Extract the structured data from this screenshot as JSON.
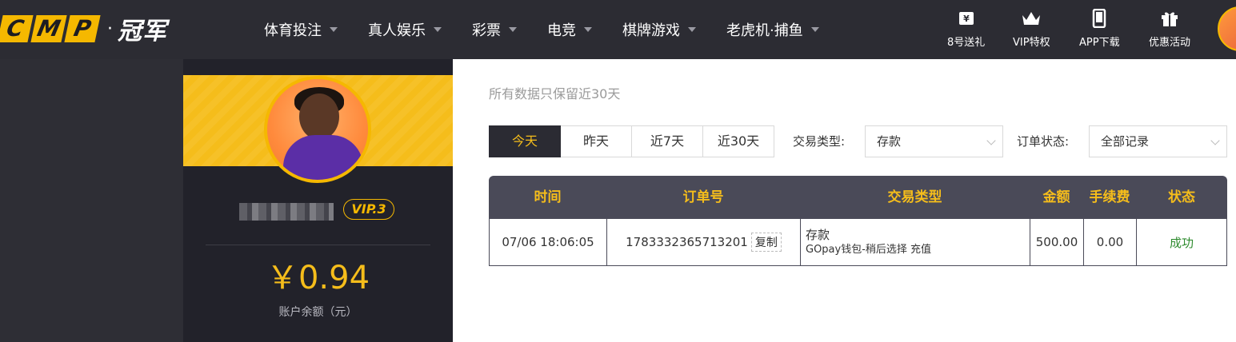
{
  "header": {
    "logo_letters": [
      "C",
      "M",
      "P"
    ],
    "logo_dot": "·",
    "brand": "冠军",
    "nav": [
      {
        "label": "体育投注"
      },
      {
        "label": "真人娱乐"
      },
      {
        "label": "彩票"
      },
      {
        "label": "电竞"
      },
      {
        "label": "棋牌游戏"
      },
      {
        "label": "老虎机·捕鱼"
      }
    ],
    "quick_links": [
      {
        "label": "8号送礼",
        "icon": "gift-yen-icon"
      },
      {
        "label": "VIP特权",
        "icon": "crown-icon"
      },
      {
        "label": "APP下载",
        "icon": "phone-icon"
      },
      {
        "label": "优惠活动",
        "icon": "gift-box-icon"
      }
    ]
  },
  "profile": {
    "vip": "VIP.3",
    "balance": "￥0.94",
    "balance_label": "账户余额（元）"
  },
  "main": {
    "note": "所有数据只保留近30天",
    "date_tabs": [
      {
        "label": "今天",
        "active": true
      },
      {
        "label": "昨天"
      },
      {
        "label": "近7天"
      },
      {
        "label": "近30天"
      }
    ],
    "tx_type_label": "交易类型:",
    "tx_type_value": "存款",
    "order_status_label": "订单状态:",
    "order_status_value": "全部记录",
    "table": {
      "columns": [
        "时间",
        "订单号",
        "交易类型",
        "金额",
        "手续费",
        "状态"
      ],
      "rows": [
        {
          "time": "07/06 18:06:05",
          "order_no": "1783332365713201",
          "copy": "复制",
          "type": "存款",
          "type_detail": "GOpay钱包-稍后选择 充值",
          "amount": "500.00",
          "fee": "0.00",
          "status": "成功"
        }
      ]
    }
  },
  "colors": {
    "accent": "#f5bd1b",
    "topbar": "#2c2c33",
    "table_header": "#4a4a58",
    "success": "#2e8b2e"
  }
}
